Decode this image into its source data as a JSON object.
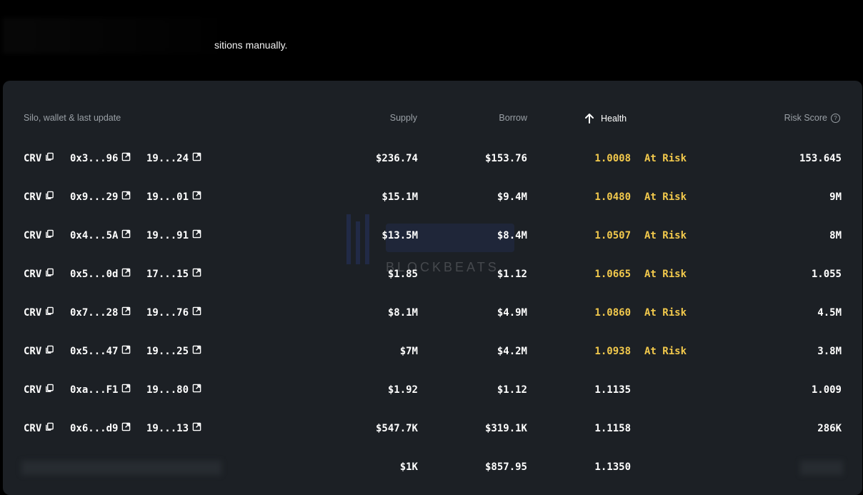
{
  "intro_text": "sitions manually.",
  "table": {
    "headers": {
      "asset": "Silo, wallet & last update",
      "supply": "Supply",
      "borrow": "Borrow",
      "health": "Health",
      "risk": "Risk Score"
    },
    "rows": [
      {
        "asset": "CRV",
        "wallet": "0x3...96",
        "update": "19...24",
        "supply": "$236.74",
        "borrow": "$153.76",
        "health": "1.0008",
        "status": "At Risk",
        "risk": "153.645"
      },
      {
        "asset": "CRV",
        "wallet": "0x9...29",
        "update": "19...01",
        "supply": "$15.1M",
        "borrow": "$9.4M",
        "health": "1.0480",
        "status": "At Risk",
        "risk": "9M"
      },
      {
        "asset": "CRV",
        "wallet": "0x4...5A",
        "update": "19...91",
        "supply": "$13.5M",
        "borrow": "$8.4M",
        "health": "1.0507",
        "status": "At Risk",
        "risk": "8M"
      },
      {
        "asset": "CRV",
        "wallet": "0x5...0d",
        "update": "17...15",
        "supply": "$1.85",
        "borrow": "$1.12",
        "health": "1.0665",
        "status": "At Risk",
        "risk": "1.055"
      },
      {
        "asset": "CRV",
        "wallet": "0x7...28",
        "update": "19...76",
        "supply": "$8.1M",
        "borrow": "$4.9M",
        "health": "1.0860",
        "status": "At Risk",
        "risk": "4.5M"
      },
      {
        "asset": "CRV",
        "wallet": "0x5...47",
        "update": "19...25",
        "supply": "$7M",
        "borrow": "$4.2M",
        "health": "1.0938",
        "status": "At Risk",
        "risk": "3.8M"
      },
      {
        "asset": "CRV",
        "wallet": "0xa...F1",
        "update": "19...80",
        "supply": "$1.92",
        "borrow": "$1.12",
        "health": "1.1135",
        "status": "",
        "risk": "1.009"
      },
      {
        "asset": "CRV",
        "wallet": "0x6...d9",
        "update": "19...13",
        "supply": "$547.7K",
        "borrow": "$319.1K",
        "health": "1.1158",
        "status": "",
        "risk": "286K"
      },
      {
        "asset": "",
        "wallet": "",
        "update": "",
        "supply": "$1K",
        "borrow": "$857.95",
        "health": "1.1350",
        "status": "",
        "risk": ""
      }
    ]
  },
  "watermark_text": "BLOCKBEATS",
  "colors": {
    "warning": "#f2c94c",
    "panel": "#1c2025",
    "muted": "#9aa0a6"
  }
}
